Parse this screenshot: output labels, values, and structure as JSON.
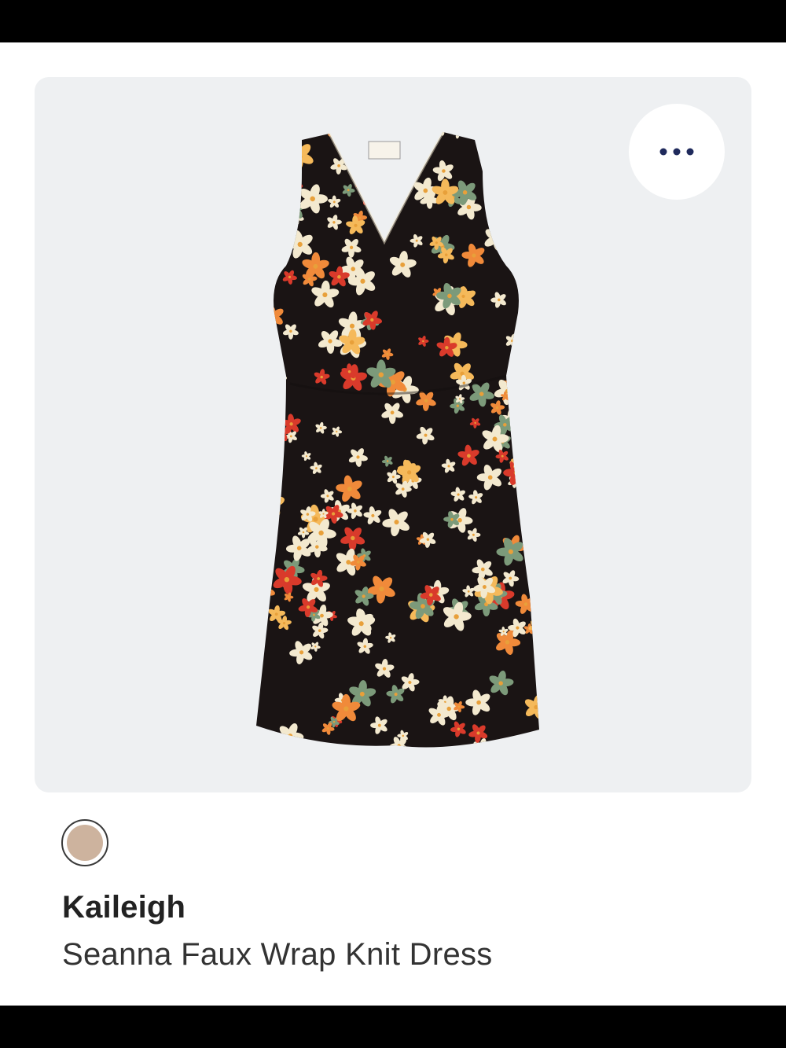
{
  "product": {
    "brand": "Kaileigh",
    "name": "Seanna Faux Wrap Knit Dress"
  },
  "swatch": {
    "color": "#cdb39e"
  },
  "icons": {
    "more": "more-horizontal-icon"
  },
  "colors": {
    "accent": "#1f2a5c",
    "card_background": "#eef0f2",
    "dress_base": "#1a1414",
    "flower_cream": "#f3e9cf",
    "flower_orange": "#f08a3a",
    "flower_red": "#d93a2b",
    "leaf_green": "#7c9a7a"
  }
}
